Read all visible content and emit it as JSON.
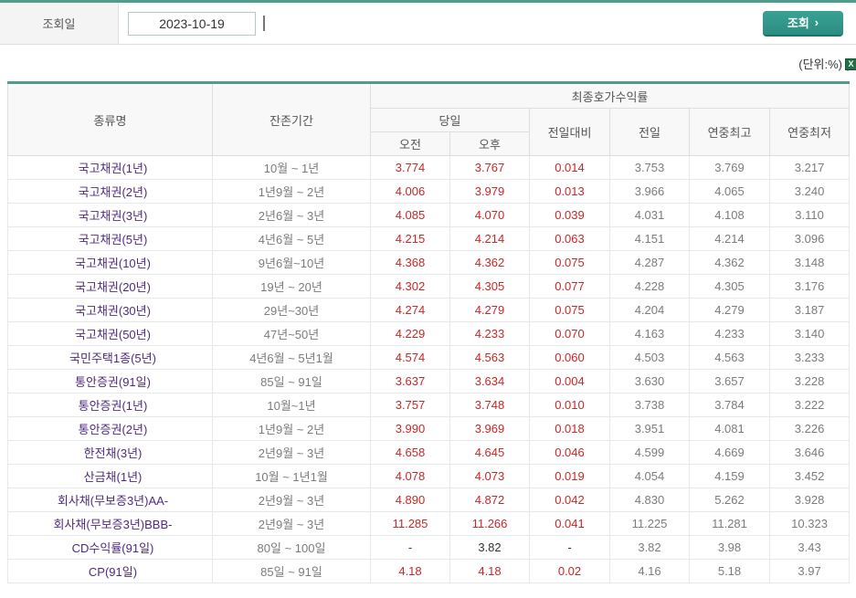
{
  "query_bar": {
    "label": "조회일",
    "date_value": "2023-10-19",
    "search_label": "조회",
    "search_chevron": "›"
  },
  "unit_note": "(단위:%)",
  "icons": {
    "calendar": "calendar-icon",
    "excel_letter": "X"
  },
  "colors": {
    "accent_teal": "#2b8d80",
    "top_border_teal": "#4e9d8d",
    "value_red": "#cc2626",
    "value_gray": "#7b7b7b",
    "name_purple": "#4f2a7f",
    "dash_navy": "#3333aa"
  },
  "table": {
    "header": {
      "col_name": "종류명",
      "col_period": "잔존기간",
      "group_yield": "최종호가수익률",
      "group_today": "당일",
      "col_am": "오전",
      "col_pm": "오후",
      "col_diff": "전일대비",
      "col_prev": "전일",
      "col_high": "연중최고",
      "col_low": "연중최저"
    },
    "rows": [
      {
        "name": "국고채권(1년)",
        "period": "10월 ~ 1년",
        "am": "3.774",
        "pm": "3.767",
        "diff": "0.014",
        "prev": "3.753",
        "high": "3.769",
        "low": "3.217"
      },
      {
        "name": "국고채권(2년)",
        "period": "1년9월 ~ 2년",
        "am": "4.006",
        "pm": "3.979",
        "diff": "0.013",
        "prev": "3.966",
        "high": "4.065",
        "low": "3.240"
      },
      {
        "name": "국고채권(3년)",
        "period": "2년6월 ~ 3년",
        "am": "4.085",
        "pm": "4.070",
        "diff": "0.039",
        "prev": "4.031",
        "high": "4.108",
        "low": "3.110"
      },
      {
        "name": "국고채권(5년)",
        "period": "4년6월 ~ 5년",
        "am": "4.215",
        "pm": "4.214",
        "diff": "0.063",
        "prev": "4.151",
        "high": "4.214",
        "low": "3.096"
      },
      {
        "name": "국고채권(10년)",
        "period": "9년6월~10년",
        "am": "4.368",
        "pm": "4.362",
        "diff": "0.075",
        "prev": "4.287",
        "high": "4.362",
        "low": "3.148"
      },
      {
        "name": "국고채권(20년)",
        "period": "19년 ~ 20년",
        "am": "4.302",
        "pm": "4.305",
        "diff": "0.077",
        "prev": "4.228",
        "high": "4.305",
        "low": "3.176"
      },
      {
        "name": "국고채권(30년)",
        "period": "29년~30년",
        "am": "4.274",
        "pm": "4.279",
        "diff": "0.075",
        "prev": "4.204",
        "high": "4.279",
        "low": "3.187"
      },
      {
        "name": "국고채권(50년)",
        "period": "47년~50년",
        "am": "4.229",
        "pm": "4.233",
        "diff": "0.070",
        "prev": "4.163",
        "high": "4.233",
        "low": "3.140"
      },
      {
        "name": "국민주택1종(5년)",
        "period": "4년6월 ~ 5년1월",
        "am": "4.574",
        "pm": "4.563",
        "diff": "0.060",
        "prev": "4.503",
        "high": "4.563",
        "low": "3.233"
      },
      {
        "name": "통안증권(91일)",
        "period": "85일 ~ 91일",
        "am": "3.637",
        "pm": "3.634",
        "diff": "0.004",
        "prev": "3.630",
        "high": "3.657",
        "low": "3.228"
      },
      {
        "name": "통안증권(1년)",
        "period": "10월~1년",
        "am": "3.757",
        "pm": "3.748",
        "diff": "0.010",
        "prev": "3.738",
        "high": "3.784",
        "low": "3.222"
      },
      {
        "name": "통안증권(2년)",
        "period": "1년9월 ~ 2년",
        "am": "3.990",
        "pm": "3.969",
        "diff": "0.018",
        "prev": "3.951",
        "high": "4.081",
        "low": "3.226"
      },
      {
        "name": "한전채(3년)",
        "period": "2년9월 ~ 3년",
        "am": "4.658",
        "pm": "4.645",
        "diff": "0.046",
        "prev": "4.599",
        "high": "4.669",
        "low": "3.646"
      },
      {
        "name": "산금채(1년)",
        "period": "10월 ~ 1년1월",
        "am": "4.078",
        "pm": "4.073",
        "diff": "0.019",
        "prev": "4.054",
        "high": "4.159",
        "low": "3.452"
      },
      {
        "name": "회사채(무보증3년)AA-",
        "period": "2년9월 ~ 3년",
        "am": "4.890",
        "pm": "4.872",
        "diff": "0.042",
        "prev": "4.830",
        "high": "5.262",
        "low": "3.928"
      },
      {
        "name": "회사채(무보증3년)BBB-",
        "period": "2년9월 ~ 3년",
        "am": "11.285",
        "pm": "11.266",
        "diff": "0.041",
        "prev": "11.225",
        "high": "11.281",
        "low": "10.323"
      },
      {
        "name": "CD수익률(91일)",
        "period": "80일 ~ 100일",
        "am": "-",
        "pm": "3.82",
        "diff": "-",
        "prev": "3.82",
        "high": "3.98",
        "low": "3.43",
        "classes": {
          "am": "v-navy",
          "pm": "v-dark",
          "diff": "v-dark"
        }
      },
      {
        "name": "CP(91일)",
        "period": "85일 ~ 91일",
        "am": "4.18",
        "pm": "4.18",
        "diff": "0.02",
        "prev": "4.16",
        "high": "5.18",
        "low": "3.97"
      }
    ]
  }
}
